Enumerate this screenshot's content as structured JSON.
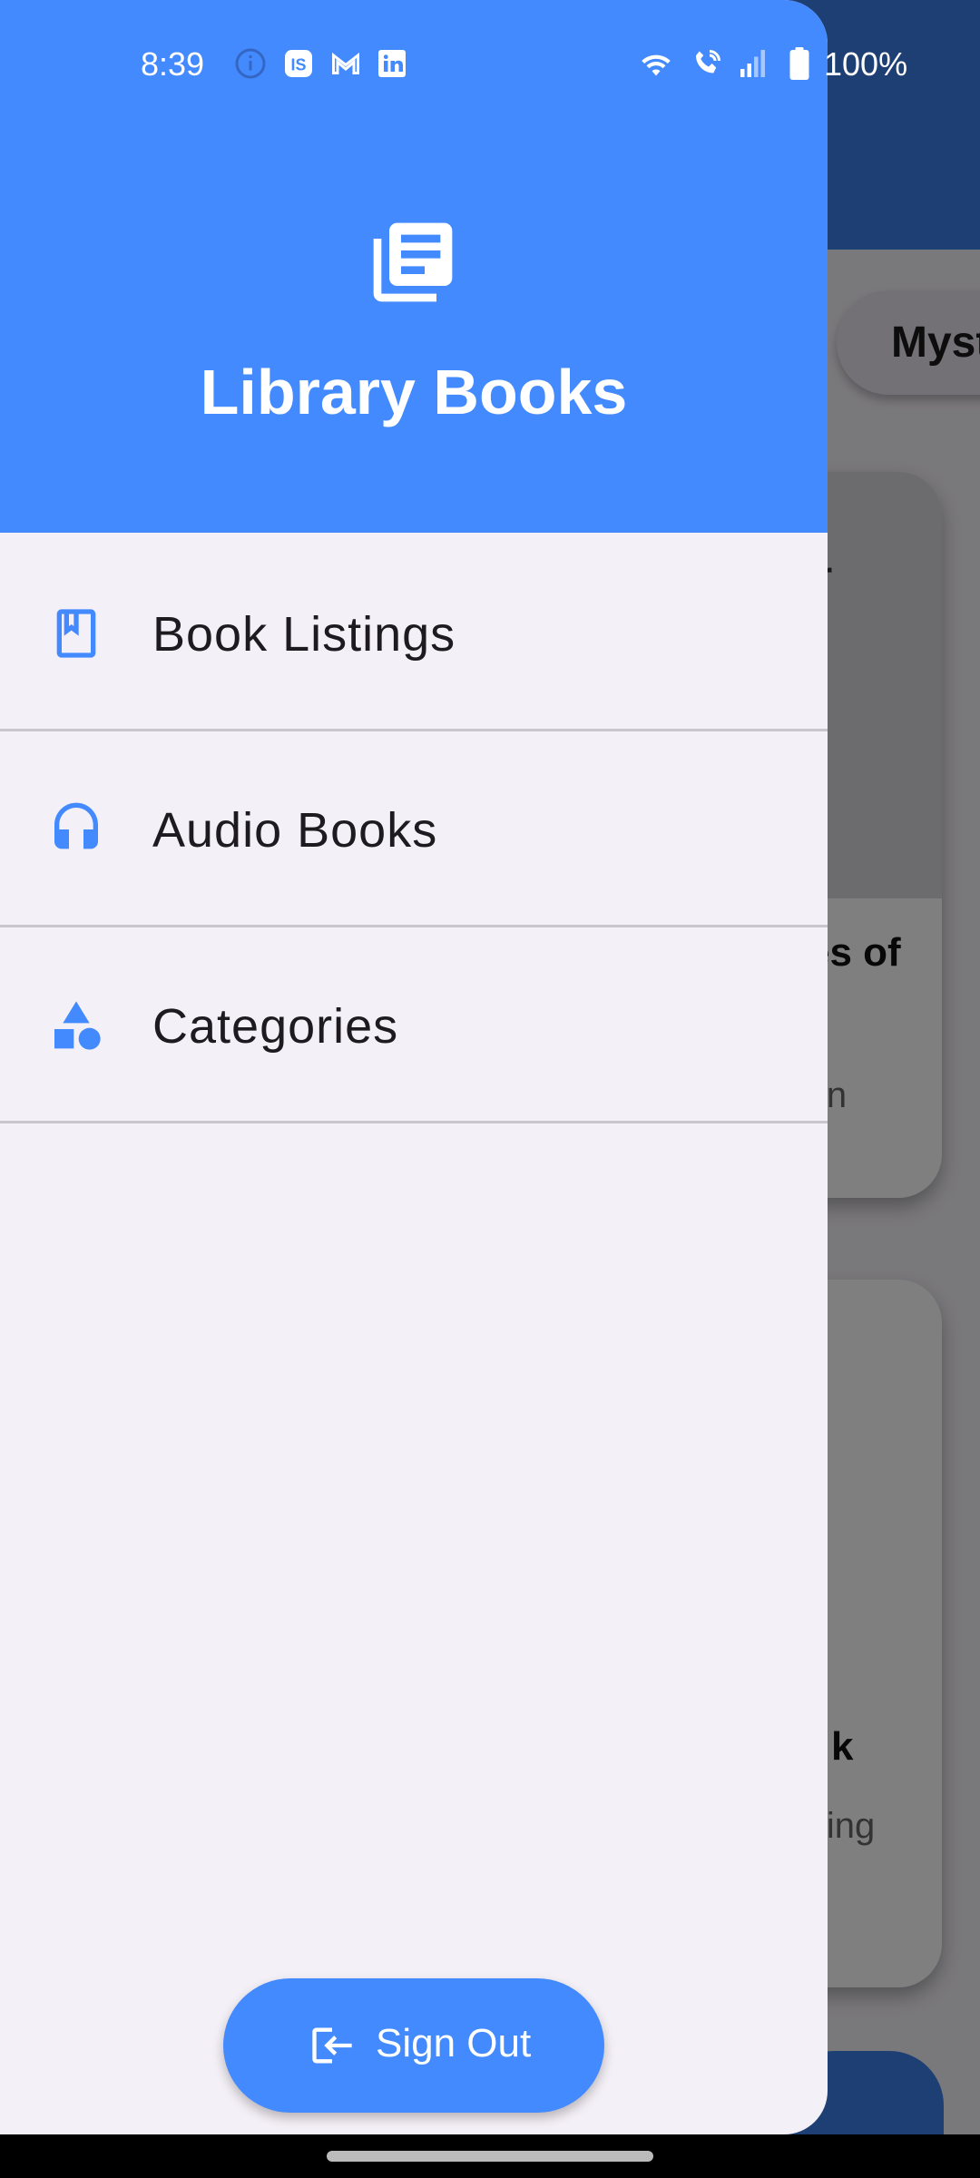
{
  "status_bar": {
    "time": "8:39",
    "battery": "100%",
    "icons": [
      "info-icon",
      "app-notification-icon",
      "gmail-icon",
      "linkedin-icon",
      "wifi-icon",
      "wifi-calling-icon",
      "signal-icon",
      "battery-icon"
    ]
  },
  "drawer": {
    "header_title": "Library Books",
    "header_icon": "library-books-icon",
    "items": [
      {
        "label": "Book Listings",
        "icon": "bookmark-book-icon"
      },
      {
        "label": "Audio Books",
        "icon": "headphones-icon"
      },
      {
        "label": "Categories",
        "icon": "shapes-icon"
      }
    ],
    "sign_out_label": "Sign Out",
    "sign_out_icon": "login-icon"
  },
  "background": {
    "chip_label": "Myst",
    "card1_title_fragment": "es of",
    "card1_top_fragment": "r",
    "card1_sub_fragment": "in",
    "card2_title_fragment": "k",
    "card2_sub_fragment": "ling"
  },
  "colors": {
    "accent": "#448aff",
    "drawer_bg": "#f4f0f7",
    "divider": "#c9c6cc",
    "text_primary": "#1d1b20"
  }
}
